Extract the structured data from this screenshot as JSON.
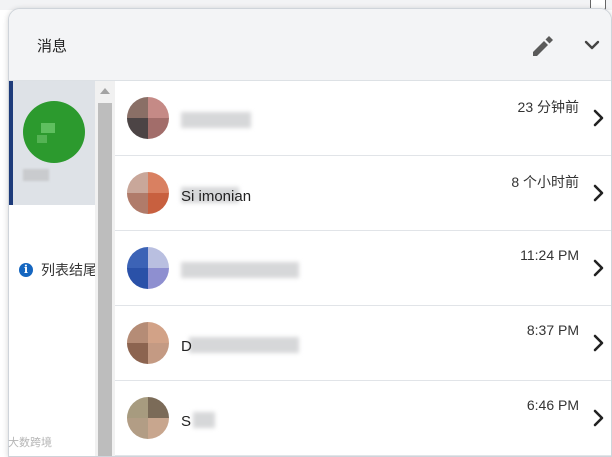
{
  "header": {
    "title": "消息",
    "compose_icon": "pencil-icon",
    "collapse_icon": "chevron-down-icon"
  },
  "rail": {
    "info_text": "列表结尾",
    "info_icon": "info-icon"
  },
  "conversations": [
    {
      "name_visible": "",
      "time": "23 分钟前"
    },
    {
      "name_visible": "Si          imonian",
      "time": "8 个小时前"
    },
    {
      "name_visible": "",
      "time": "11:24 PM"
    },
    {
      "name_visible": "D",
      "time": "8:37 PM"
    },
    {
      "name_visible": "S",
      "time": "6:46 PM"
    }
  ],
  "watermark": "大数跨境",
  "colors": {
    "rail_active_bar": "#1d3b7a",
    "info_icon": "#1566c0",
    "rail_avatar": "#2c9a2e"
  }
}
